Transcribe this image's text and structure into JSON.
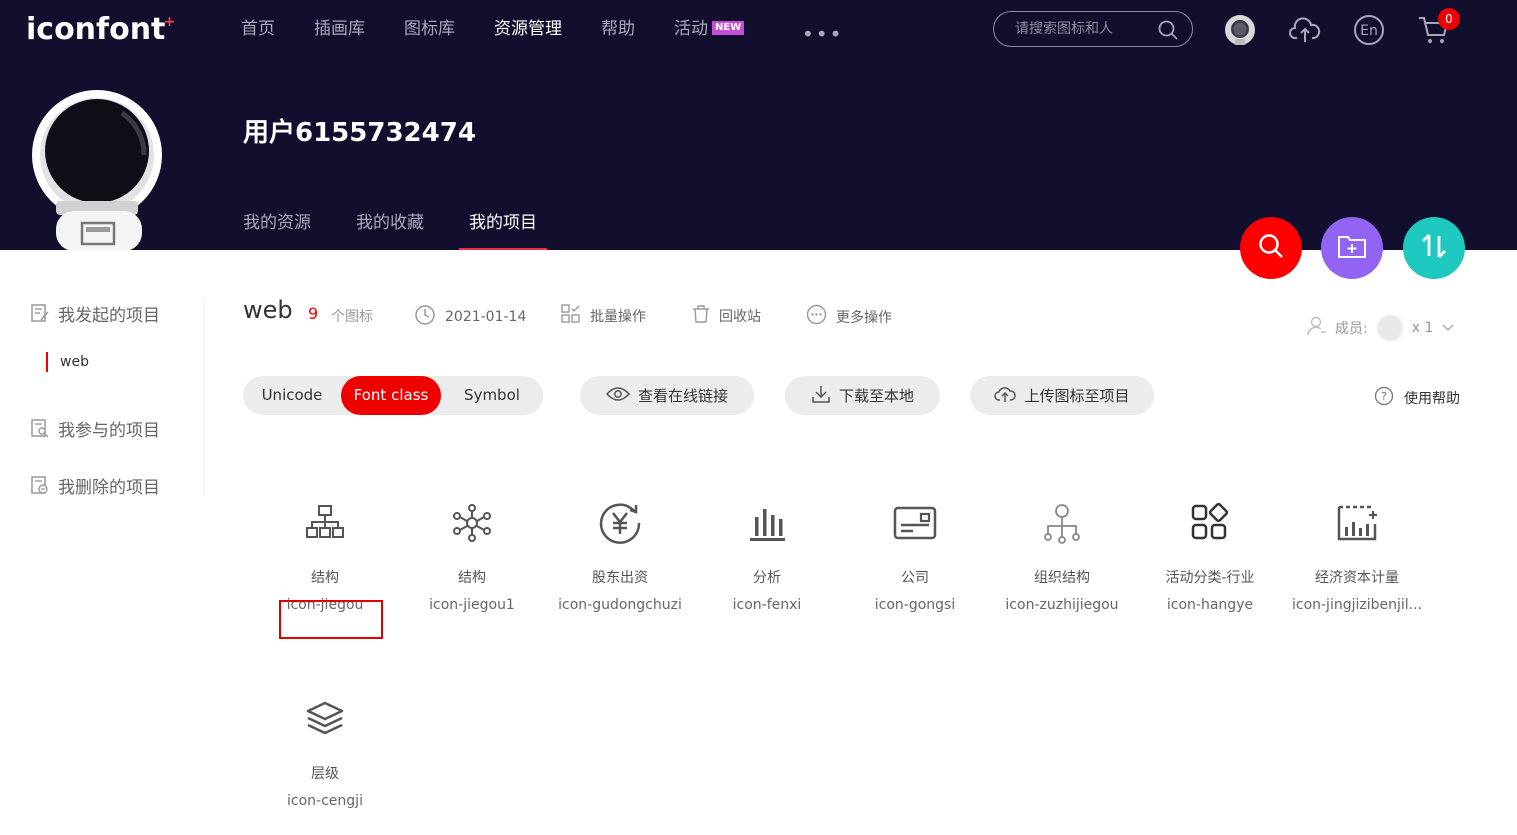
{
  "logo": {
    "text": "iconfont",
    "plus": "+"
  },
  "nav": {
    "items": [
      "首页",
      "插画库",
      "图标库",
      "资源管理",
      "帮助",
      "活动"
    ],
    "active_index": 3,
    "new_badge": "NEW",
    "more": "•••"
  },
  "search": {
    "placeholder": "请搜索图标和人"
  },
  "cart": {
    "count": "0"
  },
  "user": {
    "name": "用户6155732474"
  },
  "subnav": {
    "items": [
      "我的资源",
      "我的收藏",
      "我的项目"
    ],
    "active_index": 2
  },
  "sidebar": {
    "initiated": "我发起的项目",
    "initiated_sub": "web",
    "joined": "我参与的项目",
    "deleted": "我删除的项目"
  },
  "project": {
    "name": "web",
    "count": "9",
    "count_label": "个图标",
    "date": "2021-01-14",
    "batch": "批量操作",
    "recycle": "回收站",
    "more": "更多操作",
    "members_label": "成员:",
    "members_count": "x 1"
  },
  "format_tabs": {
    "items": [
      "Unicode",
      "Font class",
      "Symbol"
    ],
    "active_index": 1
  },
  "actions": {
    "view_link": "查看在线链接",
    "download": "下载至本地",
    "upload": "上传图标至项目",
    "help": "使用帮助"
  },
  "icons": [
    {
      "name": "结构",
      "code": "icon-jiegou",
      "icon": "org-tree-icon"
    },
    {
      "name": "结构",
      "code": "icon-jiegou1",
      "icon": "network-icon"
    },
    {
      "name": "股东出资",
      "code": "icon-gudongchuzi",
      "icon": "yen-cycle-icon"
    },
    {
      "name": "分析",
      "code": "icon-fenxi",
      "icon": "bar-chart-icon"
    },
    {
      "name": "公司",
      "code": "icon-gongsi",
      "icon": "company-card-icon"
    },
    {
      "name": "组织结构",
      "code": "icon-zuzhijiegou",
      "icon": "org-structure-icon"
    },
    {
      "name": "活动分类-行业",
      "code": "icon-hangye",
      "icon": "category-icon"
    },
    {
      "name": "经济资本计量",
      "code": "icon-jingjizibenjil...",
      "icon": "capital-chart-icon"
    },
    {
      "name": "层级",
      "code": "icon-cengji",
      "icon": "layers-icon"
    }
  ],
  "colors": {
    "header_bg": "#110f2d",
    "accent_red": "#ee0000",
    "purple": "#9364f4",
    "teal": "#1fc8c0"
  }
}
